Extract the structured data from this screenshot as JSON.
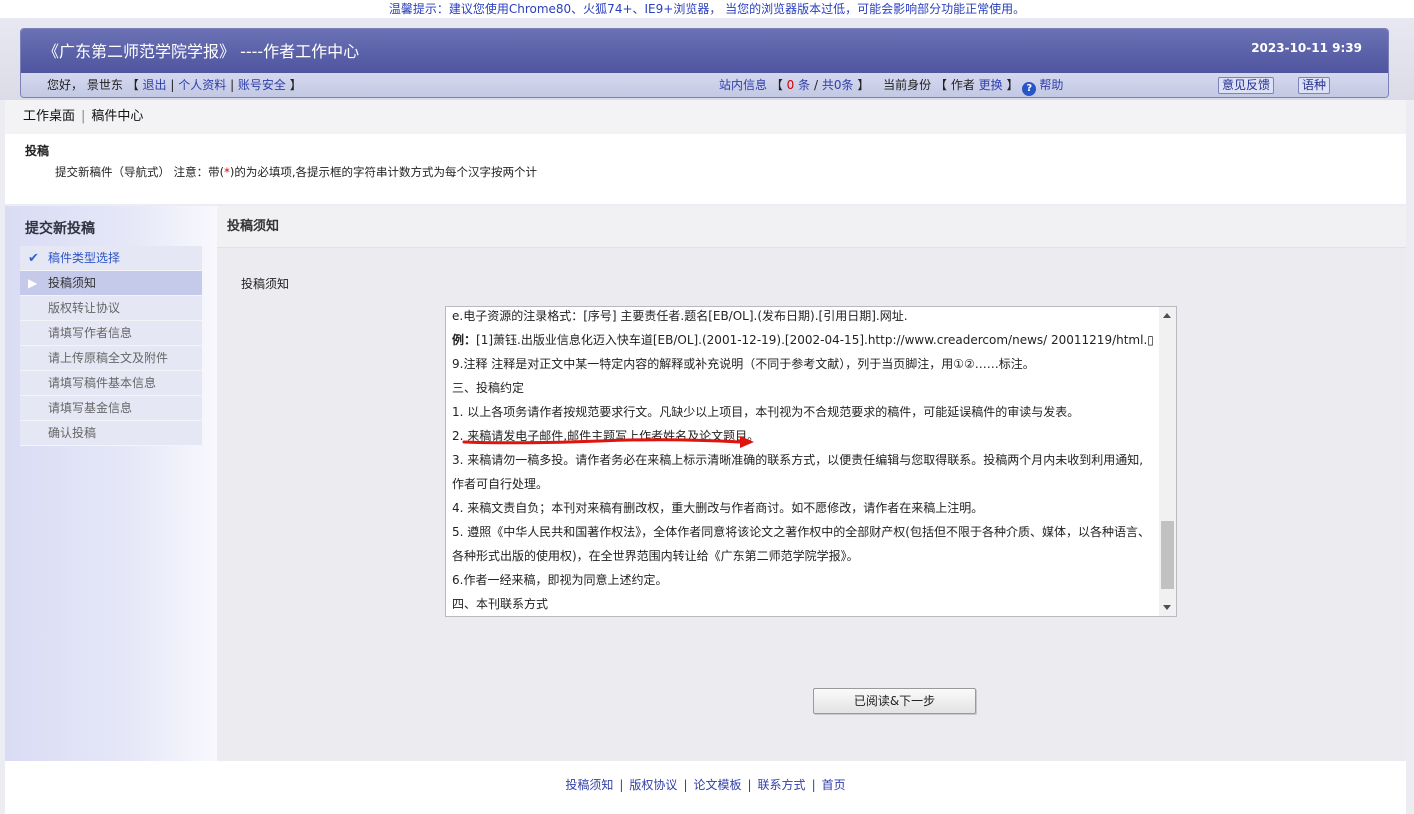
{
  "notice": "温馨提示：建议您使用Chrome80、火狐74+、IE9+浏览器， 当您的浏览器版本过低，可能会影响部分功能正常使用。",
  "header": {
    "title": "《广东第二师范学院学报》 ----作者工作中心",
    "datetime": "2023-10-11 9:39"
  },
  "userbar": {
    "greeting": "您好，",
    "username": "景世东",
    "logout": "退出",
    "profile": "个人资料",
    "security": "账号安全",
    "messages_label": "站内信息",
    "unread": "0",
    "unread_unit": "条",
    "total": "共0条",
    "role_label": "当前身份",
    "role": "作者",
    "switch": "更换",
    "help": "帮助",
    "feedback": "意见反馈",
    "language": "语种"
  },
  "breadcrumb": {
    "item1": "工作桌面",
    "item2": "稿件中心"
  },
  "info": {
    "title": "投稿",
    "desc_before": "提交新稿件（导航式） 注意：带(",
    "desc_mark": "*",
    "desc_after": ")的为必填项,各提示框的字符串计数方式为每个汉字按两个计"
  },
  "sidebar": {
    "heading": "提交新投稿",
    "steps": [
      {
        "label": "稿件类型选择",
        "state": "done"
      },
      {
        "label": "投稿须知",
        "state": "active"
      },
      {
        "label": "版权转让协议",
        "state": "pending"
      },
      {
        "label": "请填写作者信息",
        "state": "pending"
      },
      {
        "label": "请上传原稿全文及附件",
        "state": "pending"
      },
      {
        "label": "请填写稿件基本信息",
        "state": "pending"
      },
      {
        "label": "请填写基金信息",
        "state": "pending"
      },
      {
        "label": "确认投稿",
        "state": "pending"
      }
    ]
  },
  "main": {
    "heading": "投稿须知",
    "sublabel": "投稿须知",
    "lines": [
      {
        "bold": "",
        "text": "e.电子资源的注录格式：[序号] 主要责任者.题名[EB/OL].(发布日期).[引用日期].网址."
      },
      {
        "bold": "例：",
        "text": "[1]萧钰.出版业信息化迈入快车道[EB/OL].(2001-12-19).[2002-04-15].http://www.creadercom/news/ 20011219/html.▯"
      },
      {
        "bold": "",
        "text": "9.注释  注释是对正文中某一特定内容的解释或补充说明（不同于参考文献），列于当页脚注，用①②……标注。"
      },
      {
        "bold": "",
        "text": "三、投稿约定"
      },
      {
        "bold": "",
        "text": "1. 以上各项务请作者按规范要求行文。凡缺少以上项目，本刊视为不合规范要求的稿件，可能延误稿件的审读与发表。"
      },
      {
        "bold": "",
        "text": "2. 来稿请发电子邮件,邮件主题写上作者姓名及论文题目。"
      },
      {
        "bold": "",
        "text": "3. 来稿请勿一稿多投。请作者务必在来稿上标示清晰准确的联系方式，以便责任编辑与您取得联系。投稿两个月内未收到利用通知,"
      },
      {
        "bold": "",
        "text": "作者可自行处理。"
      },
      {
        "bold": "",
        "text": "4. 来稿文责自负；本刊对来稿有删改权，重大删改与作者商讨。如不愿修改，请作者在来稿上注明。"
      },
      {
        "bold": "",
        "text": "5. 遵照《中华人民共和国著作权法》，全体作者同意将该论文之著作权中的全部财产权(包括但不限于各种介质、媒体，以各种语言、"
      },
      {
        "bold": "",
        "text": "各种形式出版的使用权)，在全世界范围内转让给《广东第二师范学院学报》。"
      },
      {
        "bold": "",
        "text": "6.作者一经来稿，即视为同意上述约定。"
      },
      {
        "bold": "",
        "text": "四、本刊联系方式"
      }
    ],
    "next_button": "已阅读&下一步"
  },
  "footer": {
    "links": [
      "投稿须知",
      "版权协议",
      "论文模板",
      "联系方式",
      "首页"
    ]
  },
  "colors": {
    "header_band": "#5a60a8",
    "link": "#2f3fa8",
    "annotation_arrow": "#e0140c"
  }
}
